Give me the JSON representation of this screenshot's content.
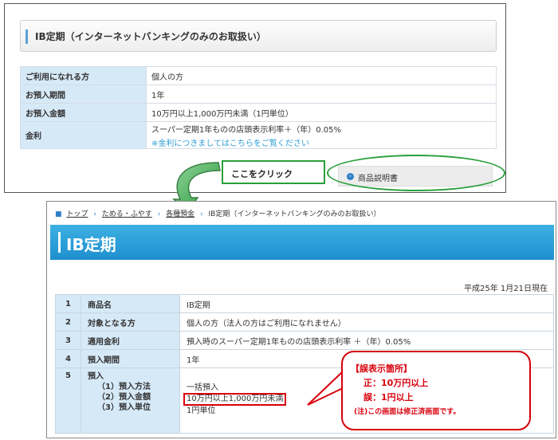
{
  "upper": {
    "header_title": "IB定期（インターネットバンキングのみのお取扱い）",
    "rows": [
      {
        "label": "ご利用になれる方",
        "value": "個人の方"
      },
      {
        "label": "お預入期間",
        "value": "1年"
      },
      {
        "label": "お預入金額",
        "value": "10万円以上1,000万円未満（1円単位）"
      },
      {
        "label": "金利",
        "value": "スーパー定期1年ものの店頭表示利率＋（年）0.05%",
        "note": "※金利につきましてはこちらをご覧ください"
      }
    ],
    "click_label": "ここをクリック",
    "doc_button_label": "商品説明書"
  },
  "lower": {
    "breadcrumb": {
      "top": "トップ",
      "save": "ためる・ふやす",
      "deposits": "各種預金",
      "current": "IB定期（インターネットバンキングのみのお取扱い）"
    },
    "page_title": "IB定期",
    "date": "平成25年 1月21日現在",
    "rows": [
      {
        "num": "1",
        "label": "商品名",
        "value": "IB定期"
      },
      {
        "num": "2",
        "label": "対象となる方",
        "value": "個人の方（法人の方はご利用になれません）"
      },
      {
        "num": "3",
        "label": "適用金利",
        "value": "預入時のスーパー定期1年ものの店頭表示利率 ＋（年）0.05%"
      },
      {
        "num": "4",
        "label": "預入期間",
        "value": "1年"
      }
    ],
    "row5": {
      "num": "5",
      "label": "預入",
      "sub": [
        {
          "label": "（1）預入方法",
          "value": "一括預入"
        },
        {
          "label": "（2）預入金額",
          "value": "10万円以上1,000万円未満"
        },
        {
          "label": "（3）預入単位",
          "value": "1円単位"
        }
      ]
    }
  },
  "callout": {
    "heading": "【誤表示箇所】",
    "correct": "正：10万円以上",
    "wrong": "誤：1円以上",
    "note": "(注)この画面は修正済画面です。"
  },
  "colors": {
    "accent_blue": "#1e8fcf",
    "table_header": "#d6e9f7",
    "highlight_green": "#29a03b",
    "error_red": "#d8000c"
  }
}
